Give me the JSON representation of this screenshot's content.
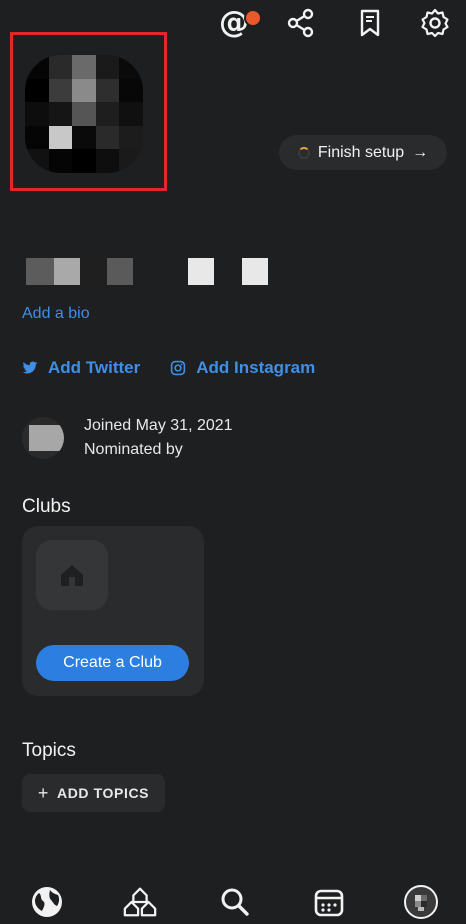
{
  "header": {
    "mentions_icon": "at-icon",
    "share_icon": "share-icon",
    "bookmark_icon": "bookmark-icon",
    "settings_icon": "gear-icon",
    "mentions_badge_color": "#e85a2b"
  },
  "profile": {
    "finish_setup_label": "Finish setup",
    "finish_setup_arrow": "→",
    "add_bio_label": "Add a bio",
    "frame_color": "#e4262b"
  },
  "socials": {
    "twitter_label": "Add Twitter",
    "instagram_label": "Add Instagram",
    "link_color": "#3f8fe6"
  },
  "joined": {
    "joined_text": "Joined May 31, 2021",
    "nominated_text": "Nominated by"
  },
  "clubs": {
    "title": "Clubs",
    "create_label": "Create a Club"
  },
  "topics": {
    "title": "Topics",
    "add_label": "ADD TOPICS",
    "add_prefix": "+"
  },
  "nav": {
    "items": [
      "globe-icon",
      "house-icon",
      "search-icon",
      "calendar-icon",
      "profile-avatar"
    ]
  }
}
